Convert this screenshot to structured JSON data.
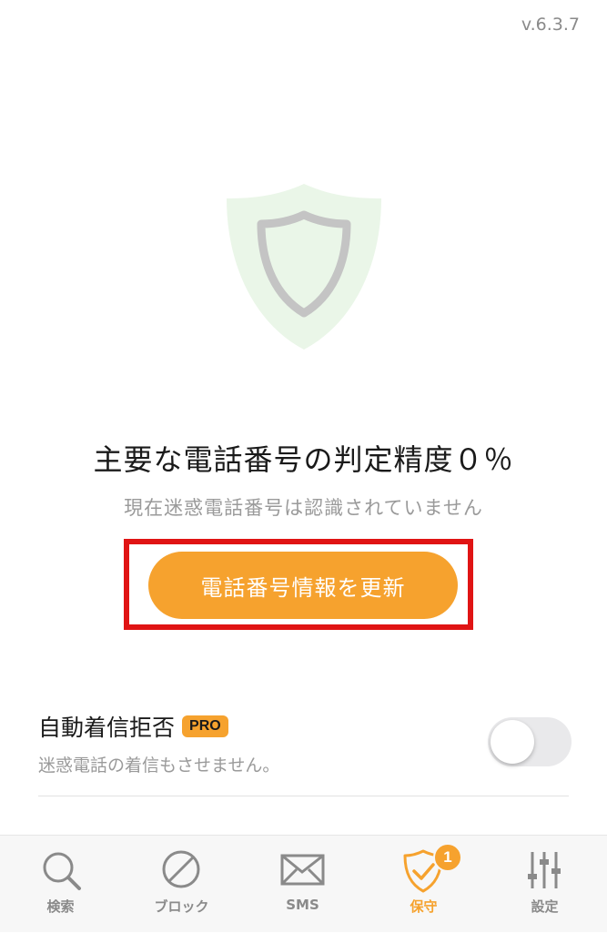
{
  "version": "v.6.3.7",
  "status": {
    "headline": "主要な電話番号の判定精度０％",
    "subline": "現在迷惑電話番号は認識されていません",
    "shield_icon": "shield-icon"
  },
  "update_button": {
    "label": "電話番号情報を更新"
  },
  "auto_block": {
    "title": "自動着信拒否",
    "badge": "PRO",
    "description": "迷惑電話の着信もさせません。",
    "enabled": false
  },
  "tabbar": {
    "items": [
      {
        "label": "検索",
        "icon": "search-icon",
        "active": false
      },
      {
        "label": "ブロック",
        "icon": "block-icon",
        "active": false
      },
      {
        "label": "SMS",
        "icon": "mail-icon",
        "active": false
      },
      {
        "label": "保守",
        "icon": "shield-check-icon",
        "active": true,
        "badge": "1"
      },
      {
        "label": "設定",
        "icon": "sliders-icon",
        "active": false
      }
    ]
  },
  "colors": {
    "accent": "#f6a22e",
    "highlight_border": "#e01414",
    "shield_fill": "#eaf6e8",
    "shield_stroke": "#c4c4c4"
  }
}
